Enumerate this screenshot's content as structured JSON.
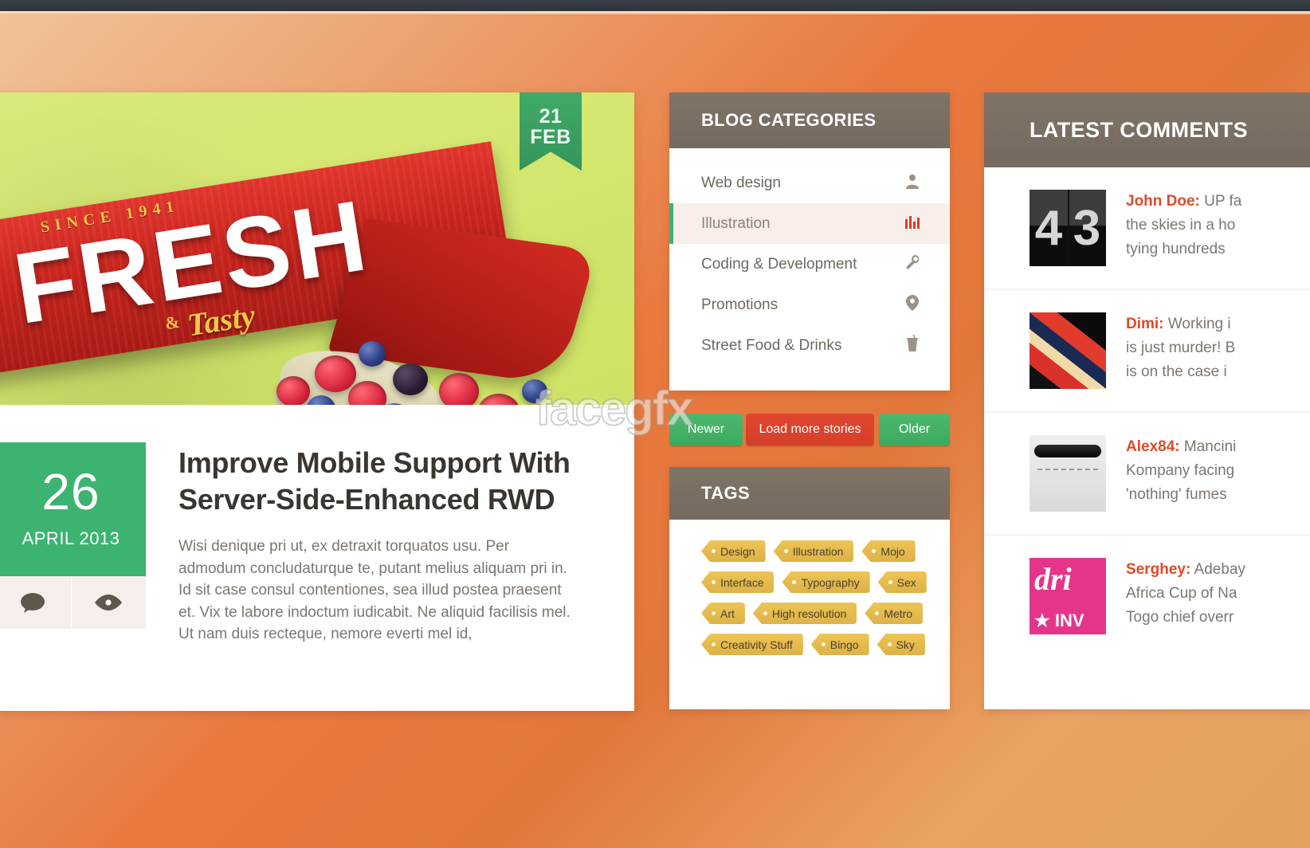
{
  "article": {
    "ribbon": {
      "day": "21",
      "month": "FEB"
    },
    "photo": {
      "label_since": "SINCE 1941",
      "label_main": "FRESH",
      "label_amp": "&",
      "label_tasty": "Tasty"
    },
    "watermark": "facegfx",
    "date_badge": {
      "day": "26",
      "month_year": "APRIL 2013"
    },
    "meta": [
      {
        "icon": "comment-icon",
        "glyph": ""
      },
      {
        "icon": "eye-icon",
        "glyph": ""
      }
    ],
    "title": "Improve Mobile Support With Server-Side-Enhanced RWD",
    "excerpt": "Wisi denique pri ut, ex detraxit torquatos usu. Per admodum concludaturque te, putant melius aliquam pri in. Id sit case consul contentiones, sea illud postea praesent et. Vix te labore indoctum iudicabit. Ne aliquid facilisis mel. Ut nam duis recteque, nemore everti mel id,"
  },
  "categories_panel": {
    "title": "BLOG CATEGORIES",
    "items": [
      {
        "label": "Web design",
        "icon": "user-icon",
        "glyph": "👤",
        "active": false
      },
      {
        "label": "Illustration",
        "icon": "bar-chart-icon",
        "glyph": "📊",
        "active": true
      },
      {
        "label": "Coding & Development",
        "icon": "wrench-icon",
        "glyph": "🔧",
        "active": false
      },
      {
        "label": "Promotions",
        "icon": "map-pin-icon",
        "glyph": "📍",
        "active": false
      },
      {
        "label": "Street Food & Drinks",
        "icon": "drink-cup-icon",
        "glyph": "☕",
        "active": false
      }
    ]
  },
  "pager": {
    "newer": "Newer",
    "load_more": "Load more stories",
    "older": "Older"
  },
  "tags_panel": {
    "title": "TAGS",
    "tags": [
      "Design",
      "Illustration",
      "Mojo",
      "Interface",
      "Typography",
      "Sex",
      "Art",
      "High resolution",
      "Metro",
      "Creativity Stuff",
      "Bingo",
      "Sky"
    ]
  },
  "comments_panel": {
    "title": "LATEST COMMENTS",
    "comments": [
      {
        "author": "John Doe:",
        "avatar": "flip-clock-avatar",
        "lines": [
          "UP fa",
          "the skies in a ho",
          "tying hundreds"
        ]
      },
      {
        "author": "Dimi:",
        "avatar": "abstract-red-avatar",
        "lines": [
          "Working i",
          "is just murder! B",
          "is on the case i"
        ]
      },
      {
        "author": "Alex84:",
        "avatar": "paper-roll-avatar",
        "lines": [
          "Mancini",
          "Kompany facing",
          "'nothing' fumes"
        ]
      },
      {
        "author": "Serghey:",
        "avatar": "dribbble-avatar",
        "lines": [
          "Adebay",
          "Africa Cup of Na",
          "Togo chief overr"
        ]
      }
    ]
  },
  "colors": {
    "accent_green": "#3cb371",
    "accent_red": "#d63f28",
    "panel_header": "#7a7064",
    "tag_yellow": "#e3bb4e",
    "author_red": "#dd4a2b"
  }
}
